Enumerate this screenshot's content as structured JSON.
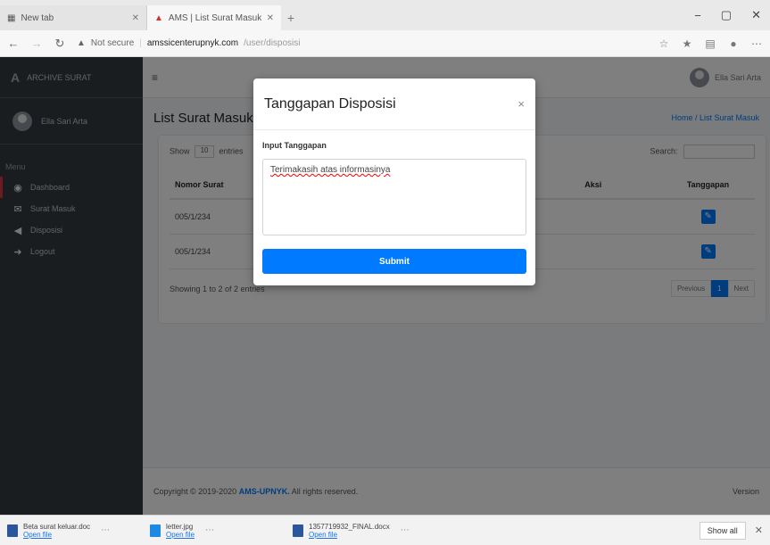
{
  "browser": {
    "tabs": [
      {
        "label": "New tab",
        "active": false
      },
      {
        "label": "AMS | List Surat Masuk",
        "active": true
      }
    ],
    "url_security": "Not secure",
    "url_host": "amssicenterupnyk.com",
    "url_path": "/user/disposisi"
  },
  "sidebar": {
    "brand": "ARCHIVE SURAT",
    "user": "Ella Sari Arta",
    "menu_header": "Menu",
    "items": [
      {
        "label": "Dashboard",
        "icon": "dashboard-icon"
      },
      {
        "label": "Surat Masuk",
        "icon": "inbox-icon"
      },
      {
        "label": "Disposisi",
        "icon": "disposisi-icon"
      },
      {
        "label": "Logout",
        "icon": "logout-icon"
      }
    ]
  },
  "topnav": {
    "user": "Ella Sari Arta"
  },
  "page": {
    "title": "List Surat Masuk",
    "breadcrumb": "Home / List Surat Masuk"
  },
  "table": {
    "show_label": "Show",
    "show_value": "10",
    "entries_label": "entries",
    "search_label": "Search:",
    "columns": [
      "Nomor Surat",
      "",
      "Aksi",
      "Tanggapan"
    ],
    "rows": [
      {
        "nomor": "005/1/234"
      },
      {
        "nomor": "005/1/234"
      }
    ],
    "info": "Showing 1 to 2 of 2 entries",
    "pager": {
      "prev": "Previous",
      "current": "1",
      "next": "Next"
    }
  },
  "footer": {
    "prefix": "Copyright © 2019-2020",
    "brand": "AMS-UPNYK.",
    "suffix": "All rights reserved.",
    "version": "Version"
  },
  "modal": {
    "title": "Tanggapan Disposisi",
    "close": "×",
    "label": "Input Tanggapan",
    "textarea_value": "Terimakasih atas informasinya",
    "submit": "Submit"
  },
  "downloads": {
    "items": [
      {
        "name": "Beta surat keluar.doc",
        "action": "Open file"
      },
      {
        "name": "letter.jpg",
        "action": "Open file"
      },
      {
        "name": "1357719932_FINAL.docx",
        "action": "Open file"
      }
    ],
    "show_all": "Show all"
  }
}
